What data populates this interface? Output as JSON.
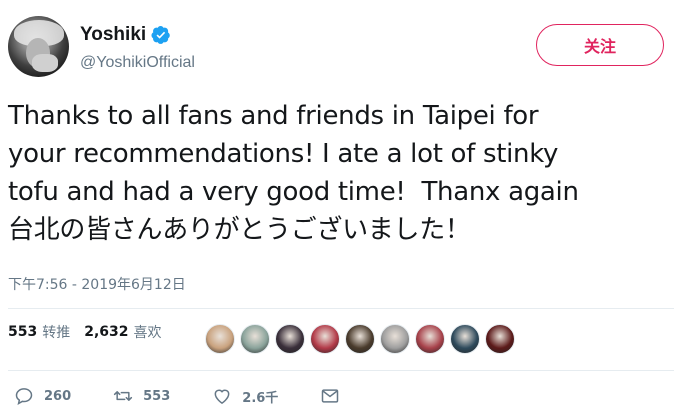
{
  "header": {
    "display_name": "Yoshiki",
    "handle": "@YoshikiOfficial",
    "follow_label": "关注"
  },
  "tweet": {
    "text": "Thanks to all fans and friends in Taipei for\nyour recommendations! I ate a lot of stinky\ntofu and had a very good time!  Thanx again\n台北の皆さんありがとうございました！",
    "timestamp": "下午7:56 - 2019年6月12日"
  },
  "stats": {
    "retweets_count": "553",
    "retweets_label": "转推",
    "likes_count": "2,632",
    "likes_label": "喜欢"
  },
  "liker_avatars": [
    {
      "color": "#c9a27e"
    },
    {
      "color": "#8aa39b"
    },
    {
      "color": "#3a2f3a"
    },
    {
      "color": "#b23a48"
    },
    {
      "color": "#4a3b2c"
    },
    {
      "color": "#9e9e9e"
    },
    {
      "color": "#a7414a"
    },
    {
      "color": "#2e4a5c"
    },
    {
      "color": "#5c1a1a"
    }
  ],
  "actions": {
    "reply_count": "260",
    "retweet_count": "553",
    "like_count": "2.6千"
  },
  "colors": {
    "accent": "#e0245e",
    "verified": "#1da1f2",
    "secondary_text": "#657786"
  }
}
